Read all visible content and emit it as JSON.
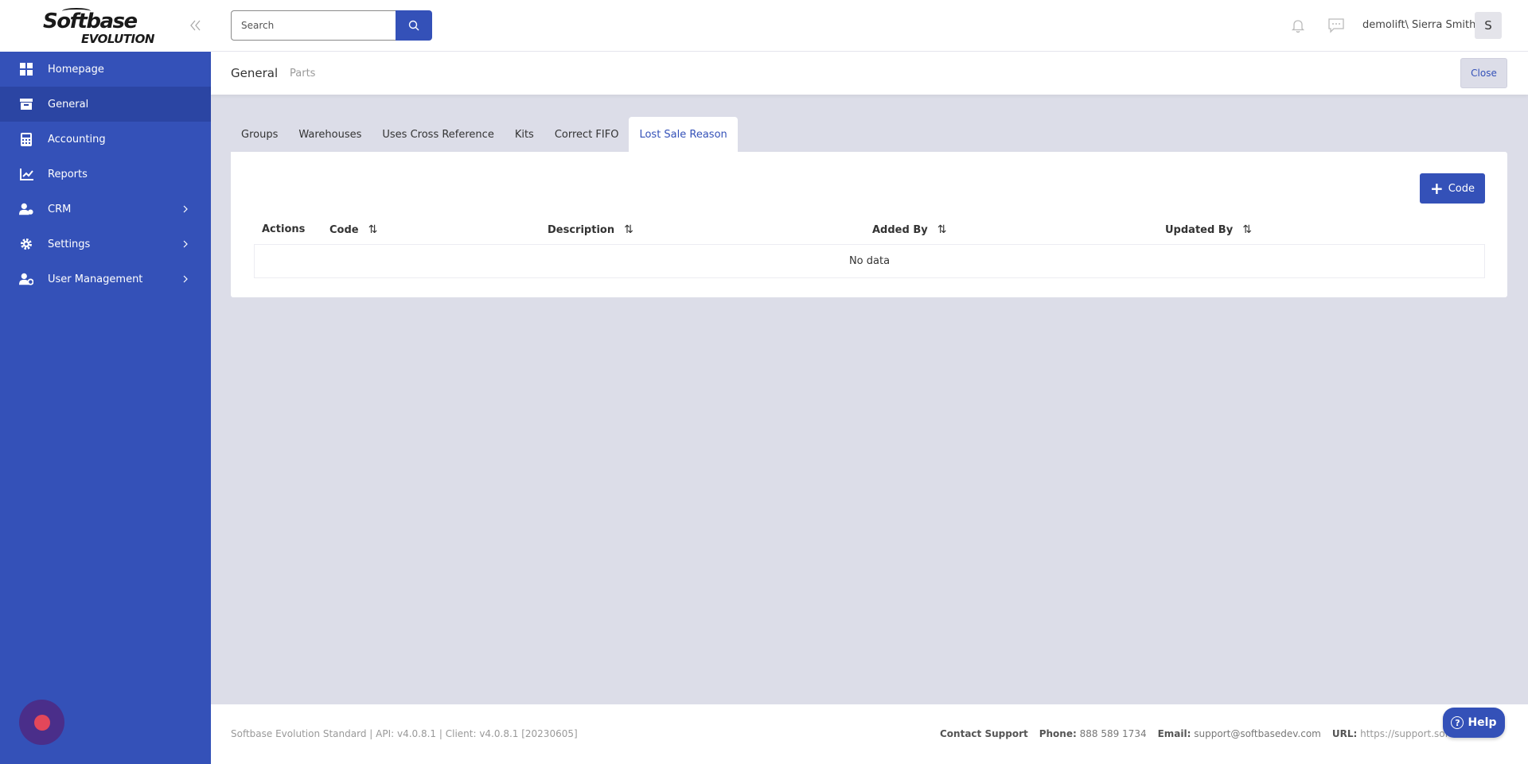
{
  "app": {
    "logo_line1": "Softbase",
    "logo_line2": "EVOLUTION"
  },
  "sidebar": {
    "items": [
      {
        "label": "Homepage",
        "icon": "grid-icon",
        "active": false,
        "has_submenu": false
      },
      {
        "label": "General",
        "icon": "archive-box-icon",
        "active": true,
        "has_submenu": false
      },
      {
        "label": "Accounting",
        "icon": "calculator-icon",
        "active": false,
        "has_submenu": false
      },
      {
        "label": "Reports",
        "icon": "chart-line-icon",
        "active": false,
        "has_submenu": false
      },
      {
        "label": "CRM",
        "icon": "user-handshake-icon",
        "active": false,
        "has_submenu": true
      },
      {
        "label": "Settings",
        "icon": "gear-icon",
        "active": false,
        "has_submenu": true
      },
      {
        "label": "User Management",
        "icon": "user-gear-icon",
        "active": false,
        "has_submenu": true
      }
    ]
  },
  "topbar": {
    "search_placeholder": "Search",
    "search_value": "",
    "username": "demolift\\ Sierra Smith",
    "avatar_initial": "S"
  },
  "subheader": {
    "title": "General",
    "crumb": "Parts",
    "close_label": "Close"
  },
  "tabs": [
    {
      "label": "Groups",
      "active": false
    },
    {
      "label": "Warehouses",
      "active": false
    },
    {
      "label": "Uses Cross Reference",
      "active": false
    },
    {
      "label": "Kits",
      "active": false
    },
    {
      "label": "Correct FIFO",
      "active": false
    },
    {
      "label": "Lost Sale Reason",
      "active": true
    }
  ],
  "card": {
    "add_button_label": "Code",
    "columns": [
      "Actions",
      "Code",
      "Description",
      "Added By",
      "Updated By"
    ],
    "sort_glyph": "⇅",
    "empty_text": "No data"
  },
  "footer": {
    "version": "Softbase Evolution Standard | API: v4.0.8.1 | Client: v4.0.8.1 [20230605]",
    "contact_label": "Contact Support",
    "phone_label": "Phone:",
    "phone_value": "888 589 1734",
    "email_label": "Email:",
    "email_value": "support@softbasedev.com",
    "url_label": "URL:",
    "url_value": "https://support.softbase",
    "help_label": "Help"
  },
  "colors": {
    "brand": "#3451b8",
    "sidebar_active": "#2b45a3",
    "content_bg": "#dcdde8"
  }
}
